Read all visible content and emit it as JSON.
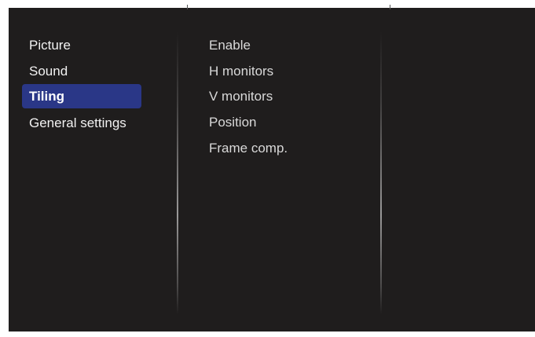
{
  "main_menu": {
    "items": [
      {
        "label": "Picture",
        "selected": false
      },
      {
        "label": "Sound",
        "selected": false
      },
      {
        "label": "Tiling",
        "selected": true
      },
      {
        "label": "General settings",
        "selected": false
      }
    ]
  },
  "submenu": {
    "items": [
      {
        "label": "Enable"
      },
      {
        "label": "H monitors"
      },
      {
        "label": "V monitors"
      },
      {
        "label": "Position"
      },
      {
        "label": "Frame comp."
      }
    ]
  },
  "colors": {
    "panel_background": "#1f1d1d",
    "selection_highlight": "#2a3787",
    "text": "#f2f2f2"
  }
}
